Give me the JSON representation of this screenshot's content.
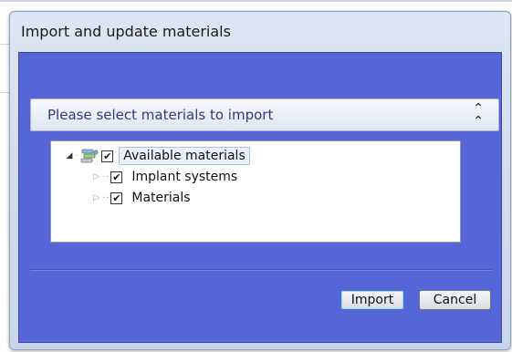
{
  "window": {
    "title": "Import and update materials"
  },
  "section": {
    "title": "Please select materials to import",
    "collapse_icon": "double-chevron-up-icon"
  },
  "tree": {
    "root": {
      "label": "Available materials",
      "checked": true,
      "expanded": true,
      "icon": "materials-icon"
    },
    "children": [
      {
        "label": "Implant systems",
        "checked": true,
        "expanded": false
      },
      {
        "label": "Materials",
        "checked": true,
        "expanded": false
      }
    ]
  },
  "buttons": {
    "import_label": "Import",
    "cancel_label": "Cancel"
  },
  "colors": {
    "client_background": "#5766d6",
    "header_text": "#333a7a",
    "focus_border": "#3d79c9"
  }
}
